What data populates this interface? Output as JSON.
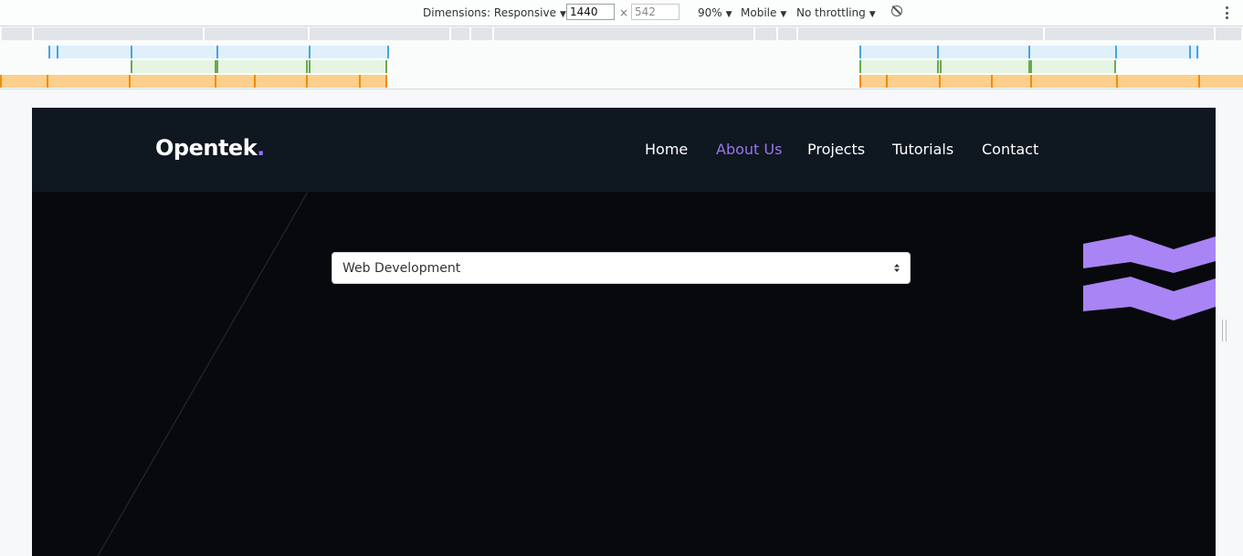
{
  "devtools": {
    "dimensions_label": "Dimensions: Responsive",
    "width_value": "1440",
    "height_placeholder": "542",
    "times_sign": "×",
    "zoom": "90%",
    "device_type": "Mobile",
    "throttling": "No throttling",
    "icons": [
      "rotate-icon",
      "more-options-icon",
      "caret-down-icon"
    ]
  },
  "site": {
    "logo_text": "Opentek",
    "logo_dot": ".",
    "nav": {
      "home": "Home",
      "about": "About Us",
      "projects": "Projects",
      "tutorials": "Tutorials",
      "contact": "Contact"
    },
    "active_nav": "About Us",
    "category_select": {
      "selected": "Web Development"
    }
  },
  "colors": {
    "nav_bg": "#0f1720",
    "hero_bg": "#07090c",
    "accent_purple": "#a984f5",
    "active_link": "#9b74ee",
    "mq_max_width": "#dff0fa",
    "mq_min_max": "#e6f4e3",
    "mq_min_width": "#fdcf8c"
  }
}
